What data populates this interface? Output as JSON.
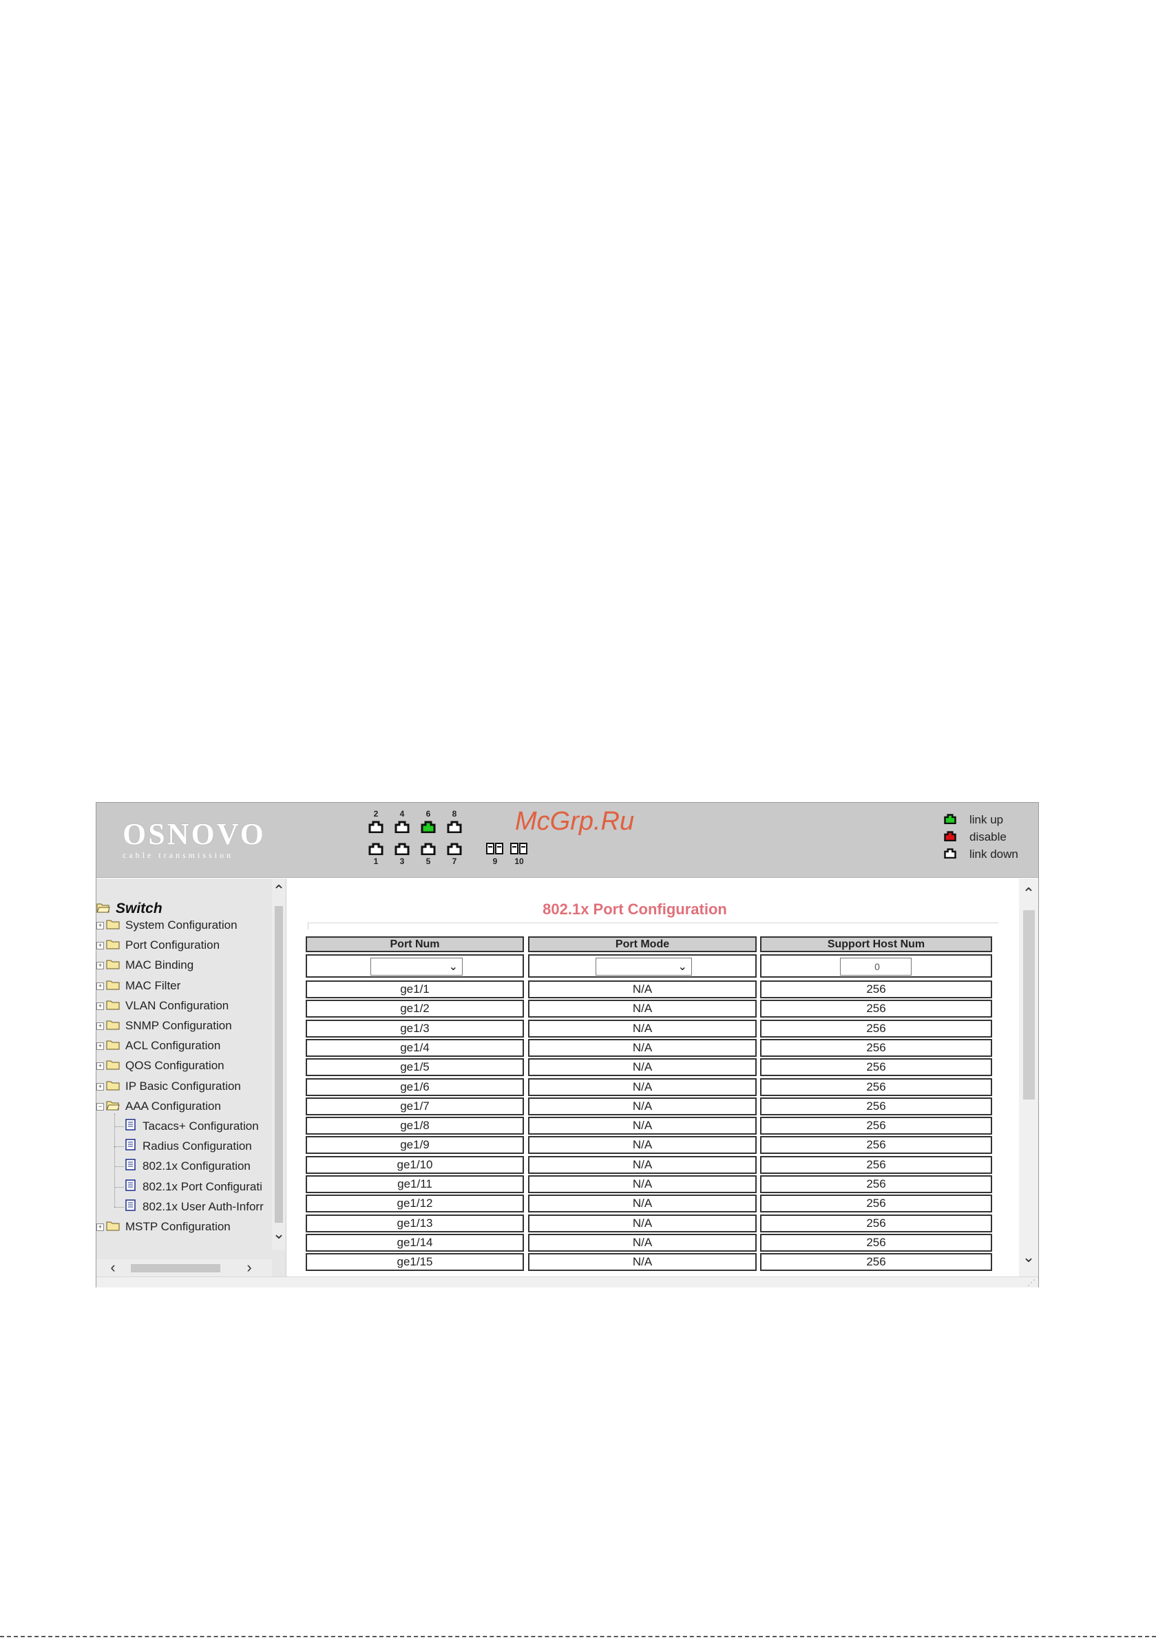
{
  "header": {
    "brand": "OSNOVO",
    "tagline": "cable transmission",
    "watermark": "McGrp.Ru",
    "ports_top": [
      {
        "num": "2",
        "status": "down"
      },
      {
        "num": "4",
        "status": "down"
      },
      {
        "num": "6",
        "status": "up"
      },
      {
        "num": "8",
        "status": "down"
      }
    ],
    "ports_bottom": [
      {
        "num": "1",
        "status": "down"
      },
      {
        "num": "3",
        "status": "down"
      },
      {
        "num": "5",
        "status": "down"
      },
      {
        "num": "7",
        "status": "down"
      }
    ],
    "sfp_ports": [
      {
        "num": "9"
      },
      {
        "num": "10"
      }
    ],
    "legend": [
      {
        "label": "link up",
        "color": "#22cc22"
      },
      {
        "label": "disable",
        "color": "#dd1111"
      },
      {
        "label": "link down",
        "color": "#ffffff"
      }
    ]
  },
  "sidebar": {
    "root_label": "Switch",
    "items": [
      {
        "label": "System Configuration",
        "type": "folder",
        "expanded": false
      },
      {
        "label": "Port Configuration",
        "type": "folder",
        "expanded": false
      },
      {
        "label": "MAC Binding",
        "type": "folder",
        "expanded": false
      },
      {
        "label": "MAC Filter",
        "type": "folder",
        "expanded": false
      },
      {
        "label": "VLAN Configuration",
        "type": "folder",
        "expanded": false
      },
      {
        "label": "SNMP Configuration",
        "type": "folder",
        "expanded": false
      },
      {
        "label": "ACL Configuration",
        "type": "folder",
        "expanded": false
      },
      {
        "label": "QOS Configuration",
        "type": "folder",
        "expanded": false
      },
      {
        "label": "IP Basic Configuration",
        "type": "folder",
        "expanded": false
      },
      {
        "label": "AAA Configuration",
        "type": "folder",
        "expanded": true
      },
      {
        "label": "Tacacs+ Configuration",
        "type": "doc"
      },
      {
        "label": "Radius Configuration",
        "type": "doc"
      },
      {
        "label": "802.1x Configuration",
        "type": "doc"
      },
      {
        "label": "802.1x Port Configurati",
        "type": "doc"
      },
      {
        "label": "802.1x User Auth-Inforr",
        "type": "doc"
      },
      {
        "label": "MSTP Configuration",
        "type": "folder",
        "expanded": false
      }
    ]
  },
  "main": {
    "title": "802.1x Port Configuration",
    "columns": [
      "Port Num",
      "Port Mode",
      "Support Host Num"
    ],
    "filter": {
      "port_num_selected": "",
      "port_mode_selected": "",
      "host_num_value": "0"
    },
    "rows": [
      {
        "port": "ge1/1",
        "mode": "N/A",
        "hosts": "256"
      },
      {
        "port": "ge1/2",
        "mode": "N/A",
        "hosts": "256"
      },
      {
        "port": "ge1/3",
        "mode": "N/A",
        "hosts": "256"
      },
      {
        "port": "ge1/4",
        "mode": "N/A",
        "hosts": "256"
      },
      {
        "port": "ge1/5",
        "mode": "N/A",
        "hosts": "256"
      },
      {
        "port": "ge1/6",
        "mode": "N/A",
        "hosts": "256"
      },
      {
        "port": "ge1/7",
        "mode": "N/A",
        "hosts": "256"
      },
      {
        "port": "ge1/8",
        "mode": "N/A",
        "hosts": "256"
      },
      {
        "port": "ge1/9",
        "mode": "N/A",
        "hosts": "256"
      },
      {
        "port": "ge1/10",
        "mode": "N/A",
        "hosts": "256"
      },
      {
        "port": "ge1/11",
        "mode": "N/A",
        "hosts": "256"
      },
      {
        "port": "ge1/12",
        "mode": "N/A",
        "hosts": "256"
      },
      {
        "port": "ge1/13",
        "mode": "N/A",
        "hosts": "256"
      },
      {
        "port": "ge1/14",
        "mode": "N/A",
        "hosts": "256"
      },
      {
        "port": "ge1/15",
        "mode": "N/A",
        "hosts": "256"
      }
    ]
  },
  "icons": {
    "port": "ethernet-port-icon",
    "sfp": "sfp-port-icon",
    "folder": "folder-icon",
    "doc": "document-icon",
    "expand": "plus-expander-icon",
    "collapse": "minus-expander-icon",
    "chevron": "chevron-down-icon"
  }
}
